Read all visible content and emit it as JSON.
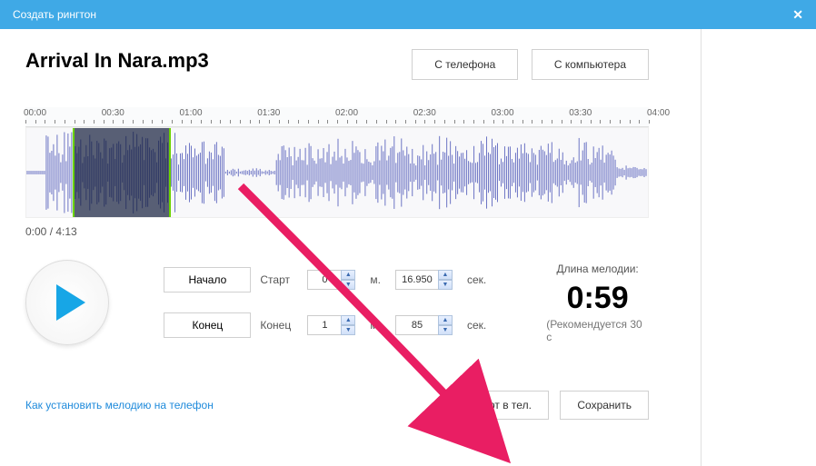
{
  "window": {
    "title": "Создать рингтон"
  },
  "header": {
    "filename": "Arrival In Nara.mp3",
    "from_phone": "С телефона",
    "from_computer": "С компьютера"
  },
  "ruler": {
    "ticks": [
      "00:00",
      "00:30",
      "01:00",
      "01:30",
      "02:00",
      "02:30",
      "03:00",
      "03:30",
      "04:00"
    ]
  },
  "playback": {
    "position_readout": "0:00 / 4:13"
  },
  "selection": {
    "start_pct": 7.5,
    "end_pct": 23.2
  },
  "controls": {
    "start_btn": "Начало",
    "end_btn": "Конец",
    "start_label": "Старт",
    "end_label": "Конец",
    "start_min": "0",
    "start_sec": "16.950",
    "end_min": "1",
    "end_sec": "85",
    "unit_min": "м.",
    "unit_sec": "сек."
  },
  "duration": {
    "title": "Длина мелодии:",
    "value": "0:59",
    "recommend": "(Рекомендуется 30 с"
  },
  "footer": {
    "help_link": "Как установить мелодию на телефон",
    "import_btn": "Импорт в тел.",
    "save_btn": "Сохранить"
  }
}
